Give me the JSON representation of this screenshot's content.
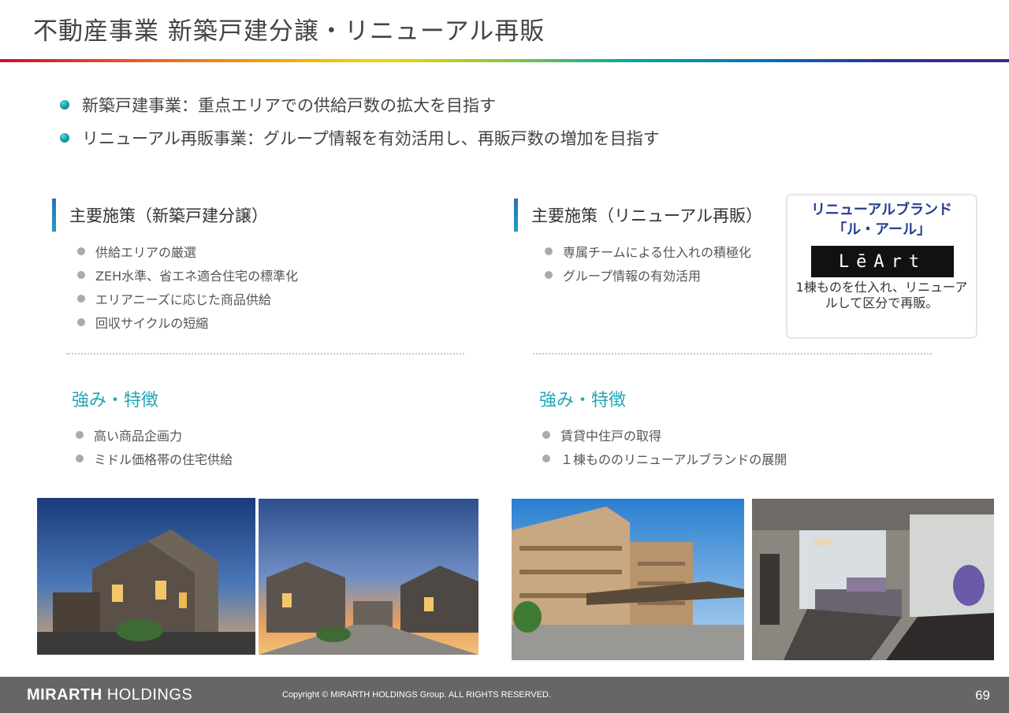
{
  "title": "不動産事業 新築戸建分譲・リニューアル再販",
  "bullets": [
    "新築戸建事業：重点エリアでの供給戸数の拡大を目指す",
    "リニューアル再販事業：グループ情報を有効活用し、再販戸数の増加を目指す"
  ],
  "left": {
    "heading": "主要施策（新築戸建分譲）",
    "measures": [
      "供給エリアの厳選",
      "ZEH水準、省エネ適合住宅の標準化",
      "エリアニーズに応じた商品供給",
      "回収サイクルの短縮"
    ],
    "strength_heading": "強み・特徴",
    "strengths": [
      "高い商品企画力",
      "ミドル価格帯の住宅供給"
    ]
  },
  "right": {
    "heading": "主要施策（リニューアル再販）",
    "measures": [
      "専属チームによる仕入れの積極化",
      "グループ情報の有効活用"
    ],
    "strength_heading": "強み・特徴",
    "strengths": [
      "賃貸中住戸の取得",
      "１棟もののリニューアルブランドの展開"
    ]
  },
  "brand": {
    "title": "リニューアルブランド「ル・アール」",
    "logo_text": "LēArt",
    "description": "1棟ものを仕入れ、リニューアルして区分で再販。"
  },
  "footer": {
    "company_bold": "MIRARTH",
    "company_rest": " HOLDINGS",
    "copyright": "Copyright © MIRARTH HOLDINGS Group. ALL RIGHTS RESERVED.",
    "page_number": "69"
  },
  "colors": {
    "accent_teal": "#1fa7b5",
    "brand_navy": "#243f8f",
    "footer_gray": "#666666"
  }
}
